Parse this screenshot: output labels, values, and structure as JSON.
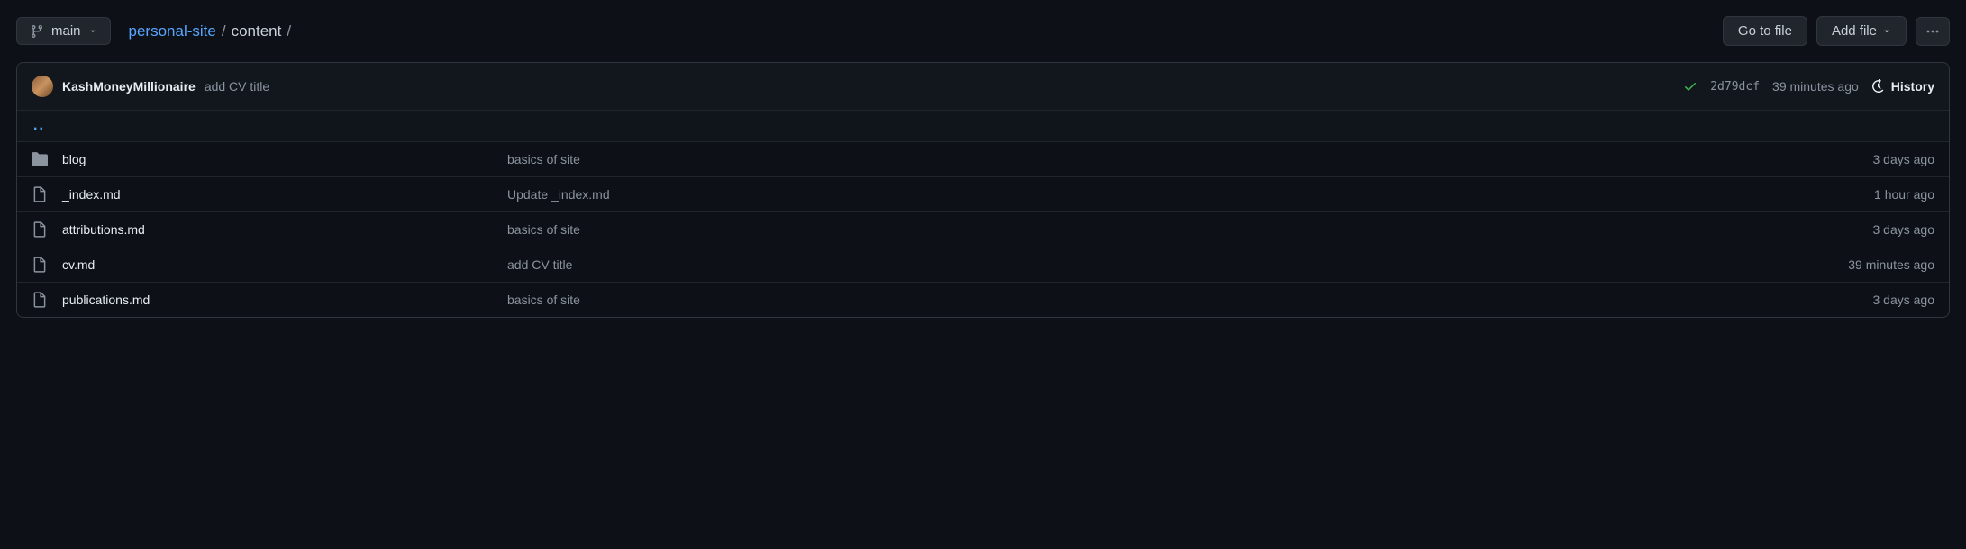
{
  "branch": "main",
  "breadcrumb": {
    "repo": "personal-site",
    "folder": "content"
  },
  "actions": {
    "goto": "Go to file",
    "add": "Add file"
  },
  "commit": {
    "author": "KashMoneyMillionaire",
    "message": "add CV title",
    "sha": "2d79dcf",
    "time": "39 minutes ago",
    "history": "History"
  },
  "parent_dir": "..",
  "files": [
    {
      "type": "dir",
      "name": "blog",
      "message": "basics of site",
      "age": "3 days ago"
    },
    {
      "type": "file",
      "name": "_index.md",
      "message": "Update _index.md",
      "age": "1 hour ago"
    },
    {
      "type": "file",
      "name": "attributions.md",
      "message": "basics of site",
      "age": "3 days ago"
    },
    {
      "type": "file",
      "name": "cv.md",
      "message": "add CV title",
      "age": "39 minutes ago"
    },
    {
      "type": "file",
      "name": "publications.md",
      "message": "basics of site",
      "age": "3 days ago"
    }
  ]
}
